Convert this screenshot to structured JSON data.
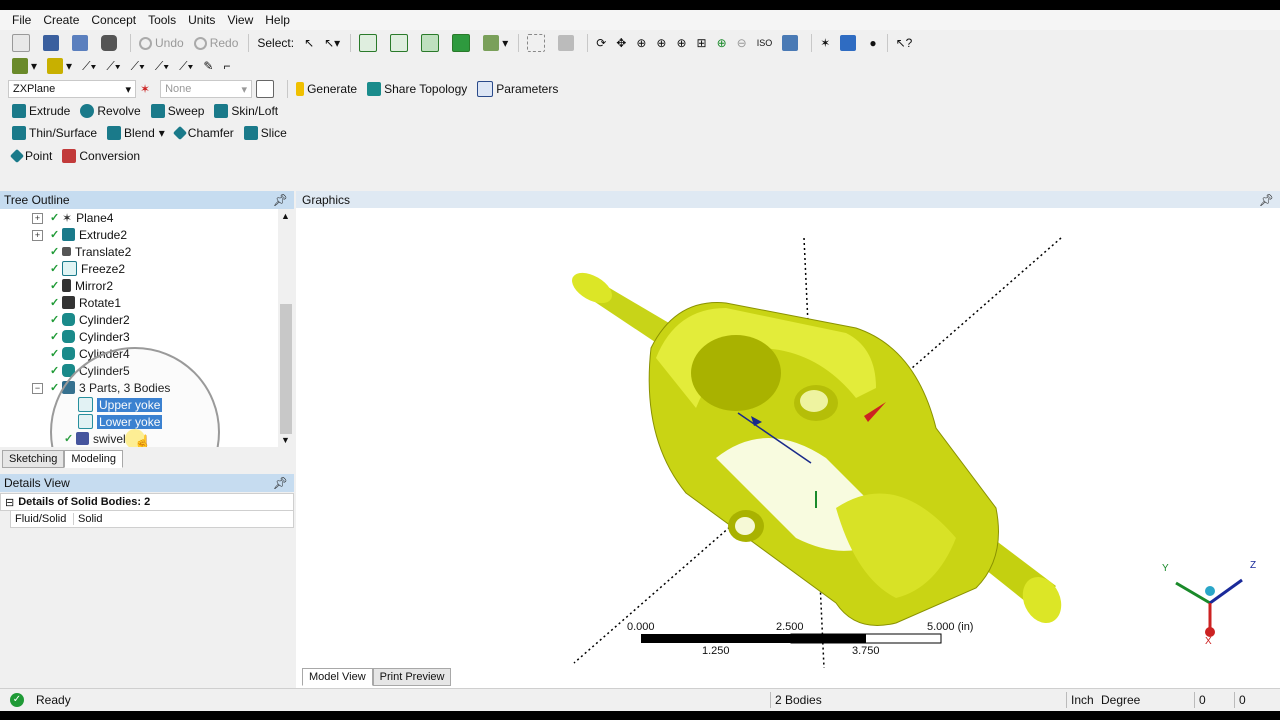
{
  "menu": [
    "File",
    "Create",
    "Concept",
    "Tools",
    "Units",
    "View",
    "Help"
  ],
  "toolbar1": {
    "undo": "Undo",
    "redo": "Redo",
    "select": "Select:"
  },
  "toolbar3": {
    "plane_combo": "ZXPlane",
    "sketch_combo": "None",
    "generate": "Generate",
    "share_topology": "Share Topology",
    "parameters": "Parameters"
  },
  "toolbar4": [
    "Extrude",
    "Revolve",
    "Sweep",
    "Skin/Loft"
  ],
  "toolbar5": [
    "Thin/Surface",
    "Blend",
    "Chamfer",
    "Slice"
  ],
  "toolbar6": [
    "Point",
    "Conversion"
  ],
  "tree_outline": {
    "title": "Tree Outline",
    "items": [
      "Plane4",
      "Extrude2",
      "Translate2",
      "Freeze2",
      "Mirror2",
      "Rotate1",
      "Cylinder2",
      "Cylinder3",
      "Cylinder4",
      "Cylinder5",
      "3 Parts, 3 Bodies",
      "Upper yoke",
      "Lower yoke",
      "swivel"
    ],
    "tabs": [
      "Sketching",
      "Modeling"
    ]
  },
  "details": {
    "title": "Details View",
    "header": "Details of Solid Bodies: 2",
    "row_label": "Fluid/Solid",
    "row_value": "Solid"
  },
  "graphics": {
    "title": "Graphics",
    "scale_top": [
      "0.000",
      "2.500",
      "5.000 (in)"
    ],
    "scale_bottom": [
      "1.250",
      "3.750"
    ],
    "triad": [
      "Y",
      "Z",
      "X"
    ],
    "tabs": [
      "Model View",
      "Print Preview"
    ]
  },
  "status": {
    "ready": "Ready",
    "selection": "2 Bodies",
    "units_length": "Inch",
    "units_angle": "Degree",
    "val1": "0",
    "val2": "0"
  },
  "colors": {
    "model": "#d7e21a",
    "selection": "#2f7bd1",
    "panel_header": "#c6dcf0"
  }
}
